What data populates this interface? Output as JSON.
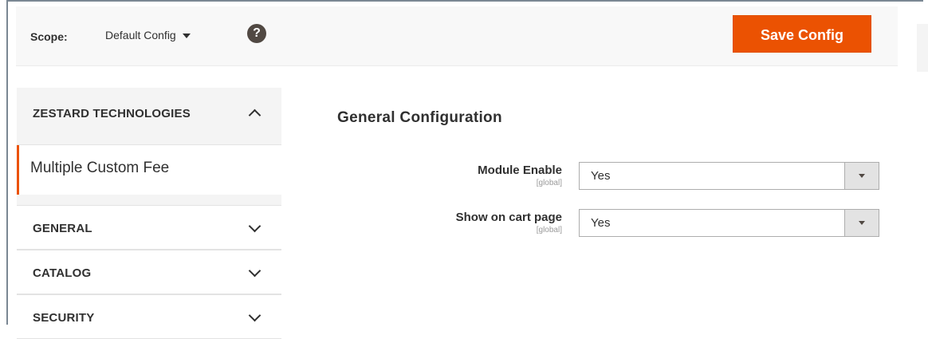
{
  "toolbar": {
    "scope_label": "Scope:",
    "scope_value": "Default Config",
    "help_glyph": "?",
    "save_label": "Save Config"
  },
  "sidebar": {
    "sections": [
      {
        "label": "ZESTARD TECHNOLOGIES",
        "expanded": true,
        "items": [
          {
            "label": "Multiple Custom Fee",
            "active": true
          }
        ]
      },
      {
        "label": "GENERAL",
        "expanded": false
      },
      {
        "label": "CATALOG",
        "expanded": false
      },
      {
        "label": "SECURITY",
        "expanded": false
      }
    ]
  },
  "main": {
    "title": "General Configuration",
    "fields": [
      {
        "label": "Module Enable",
        "scope": "[global]",
        "value": "Yes"
      },
      {
        "label": "Show on cart page",
        "scope": "[global]",
        "value": "Yes"
      }
    ]
  },
  "colors": {
    "accent": "#eb5202",
    "toolbar_bg": "#f8f8f8",
    "sidebar_bg": "#f4f4f4",
    "text": "#303030"
  },
  "icons": [
    "caret-down-icon",
    "help-icon",
    "chevron-up-icon",
    "chevron-down-icon",
    "select-arrow-icon"
  ]
}
